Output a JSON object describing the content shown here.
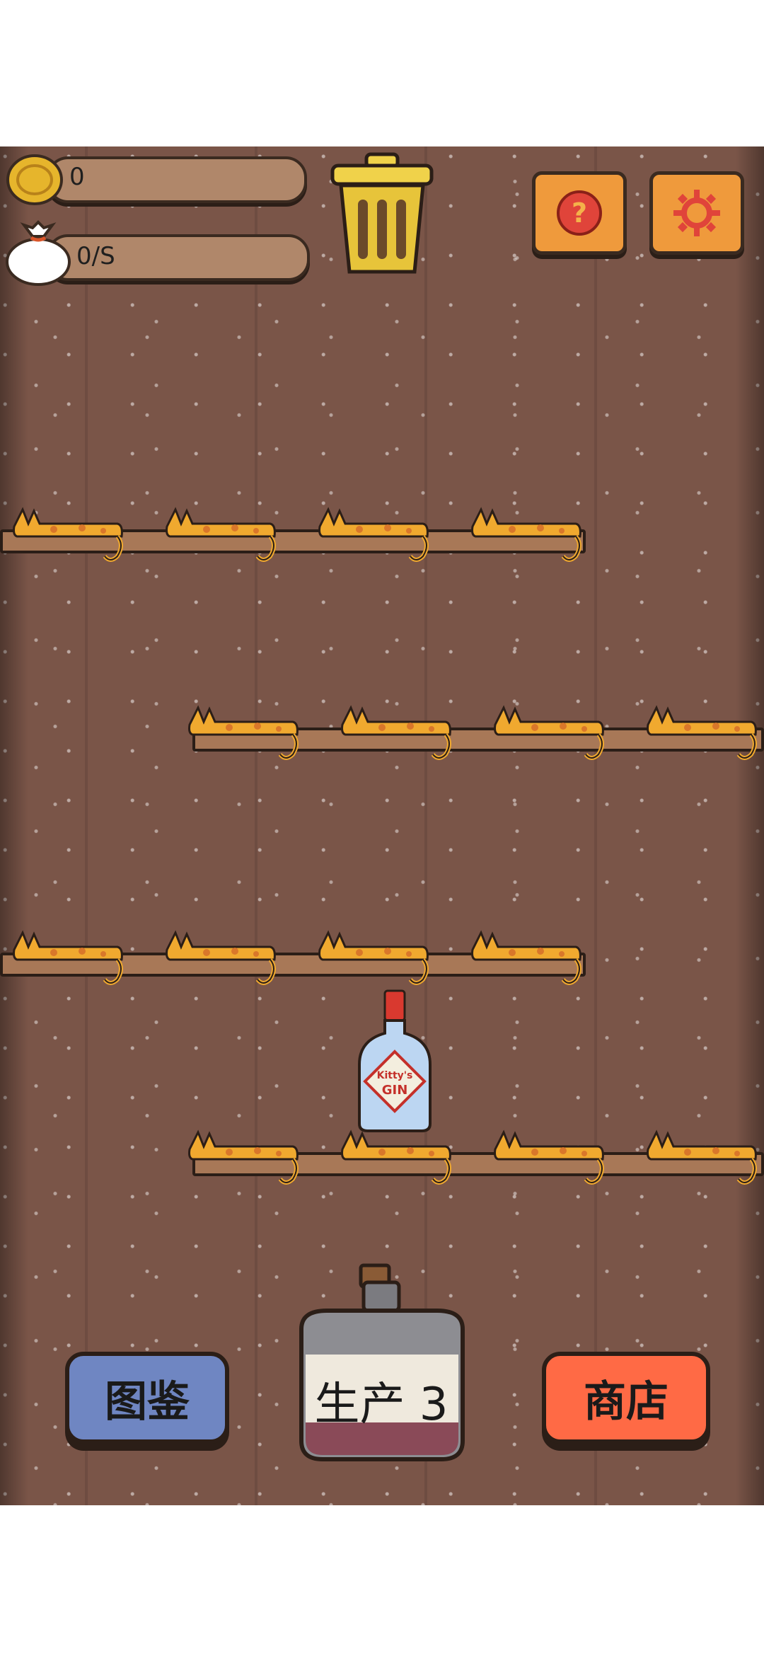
{
  "hud": {
    "coins": "0",
    "rate": "0/S"
  },
  "buttons": {
    "help_icon": "question-icon",
    "settings_icon": "gear-icon",
    "trash_icon": "trash-icon",
    "collection": "图鉴",
    "produce": "生产 3",
    "shop": "商店"
  },
  "items": {
    "bottle_label_line1": "Kitty's",
    "bottle_label_line2": "GIN"
  },
  "colors": {
    "wood_bg": "#7a5548",
    "collection_btn": "#6f86c2",
    "shop_btn": "#ff6a45",
    "icon_btn": "#ef9a3c",
    "cat": "#f0a92f"
  }
}
